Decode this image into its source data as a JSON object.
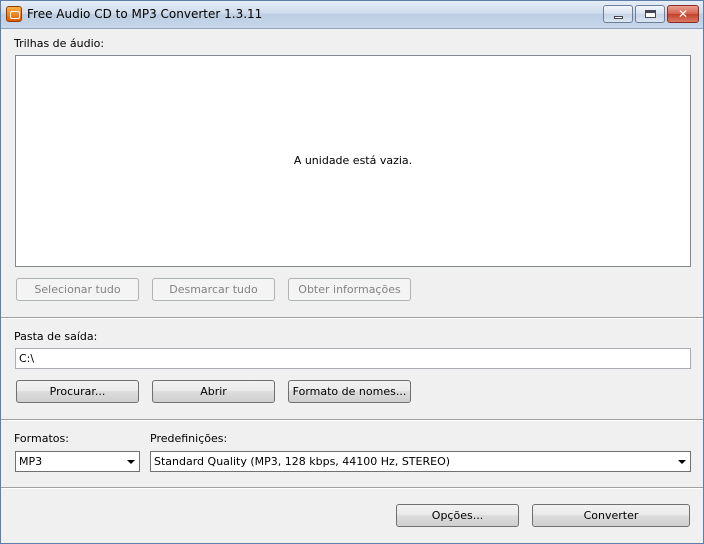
{
  "window": {
    "title": "Free Audio CD to MP3 Converter 1.3.11"
  },
  "tracks": {
    "label": "Trilhas de áudio:",
    "empty_message": "A unidade está vazia.",
    "select_all": "Selecionar tudo",
    "deselect_all": "Desmarcar tudo",
    "get_info": "Obter informações"
  },
  "output": {
    "label": "Pasta de saída:",
    "path": "C:\\",
    "browse": "Procurar...",
    "open": "Abrir",
    "naming": "Formato de nomes..."
  },
  "formats": {
    "label": "Formatos:",
    "selected": "MP3",
    "presets_label": "Predefinições:",
    "preset_selected": "Standard Quality (MP3, 128 kbps, 44100 Hz, STEREO)"
  },
  "footer": {
    "options": "Opções...",
    "convert": "Converter"
  }
}
